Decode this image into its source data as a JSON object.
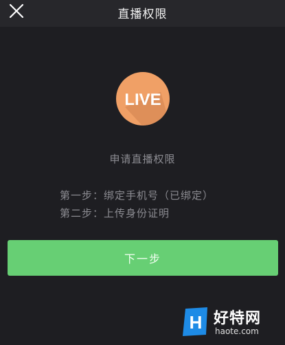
{
  "header": {
    "title": "直播权限",
    "close_icon": "close-icon"
  },
  "badge": {
    "text": "LIVE",
    "color": "#f0a066",
    "shadow_color": "#c8794a"
  },
  "main": {
    "apply_title": "申请直播权限",
    "step1": "第一步：绑定手机号（已绑定）",
    "step2": "第二步：上传身份证明"
  },
  "next_button": {
    "label": "下一步",
    "color": "#67cf74"
  },
  "watermark": {
    "name": "好特网",
    "url": "haote.com",
    "logo_letter": "H",
    "logo_color": "#1e8be6"
  }
}
